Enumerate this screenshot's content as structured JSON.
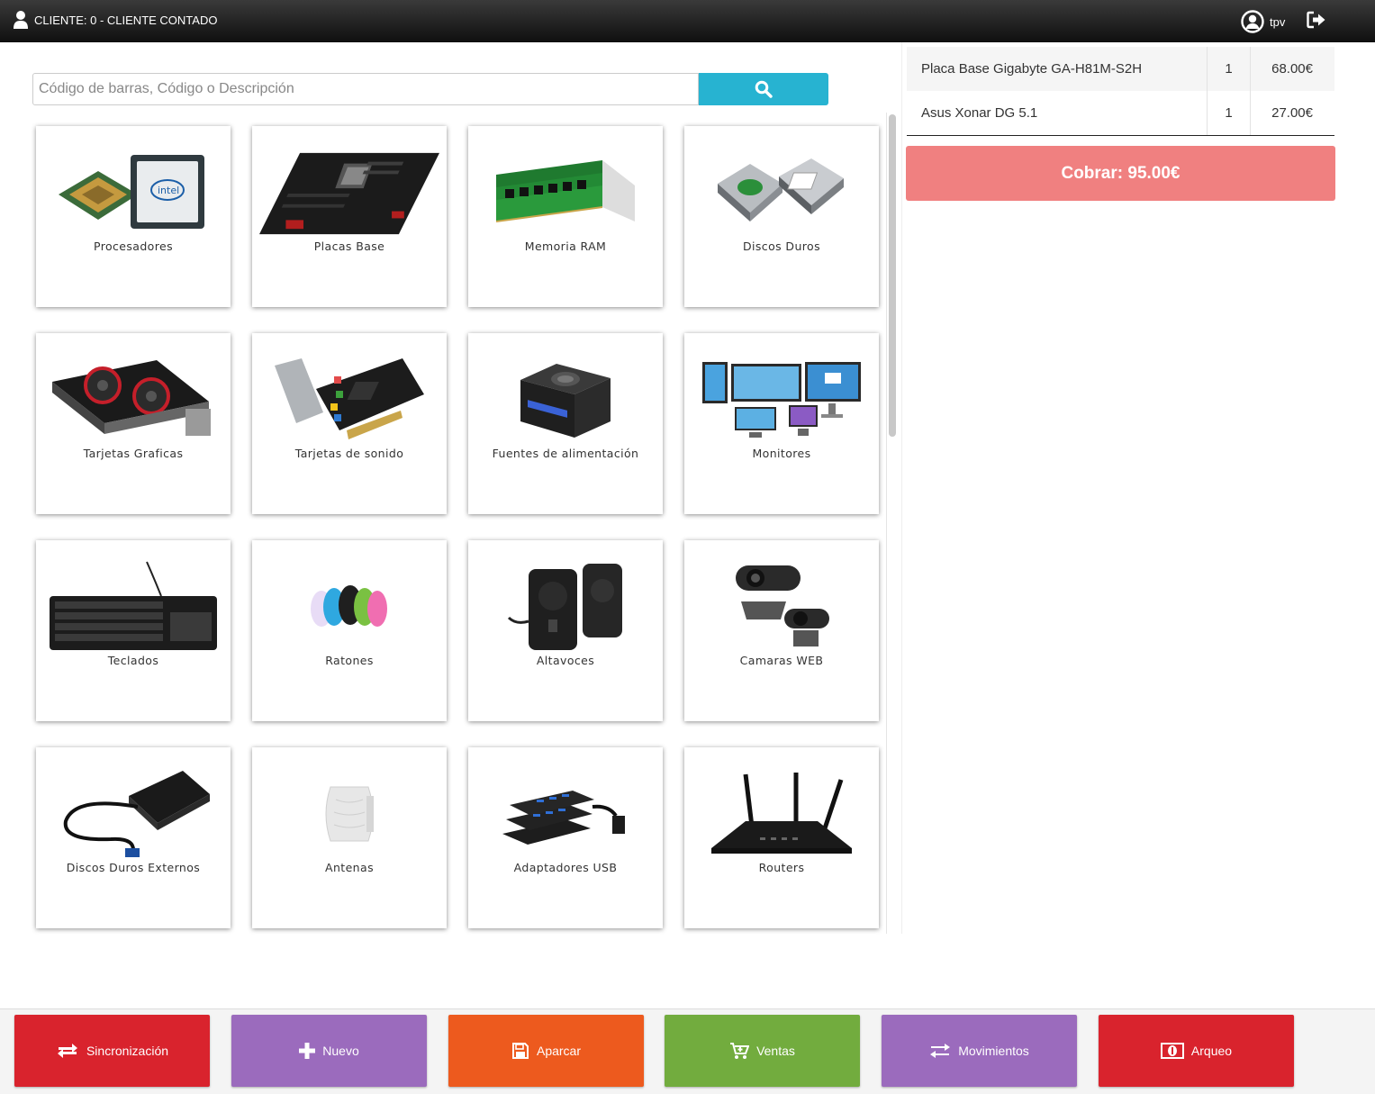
{
  "header": {
    "client_label": "CLIENTE: 0 - CLIENTE CONTADO",
    "user_label": "tpv"
  },
  "search": {
    "placeholder": "Código de barras, Código o Descripción"
  },
  "categories": [
    {
      "label": "Procesadores",
      "icon": "cpu"
    },
    {
      "label": "Placas Base",
      "icon": "motherboard"
    },
    {
      "label": "Memoria RAM",
      "icon": "ram"
    },
    {
      "label": "Discos Duros",
      "icon": "hdd"
    },
    {
      "label": "Tarjetas Graficas",
      "icon": "gpu"
    },
    {
      "label": "Tarjetas de sonido",
      "icon": "soundcard"
    },
    {
      "label": "Fuentes de alimentación",
      "icon": "psu"
    },
    {
      "label": "Monitores",
      "icon": "monitors"
    },
    {
      "label": "Teclados",
      "icon": "keyboard"
    },
    {
      "label": "Ratones",
      "icon": "mice"
    },
    {
      "label": "Altavoces",
      "icon": "speakers"
    },
    {
      "label": "Camaras WEB",
      "icon": "webcam"
    },
    {
      "label": "Discos Duros Externos",
      "icon": "external-hdd"
    },
    {
      "label": "Antenas",
      "icon": "antenna"
    },
    {
      "label": "Adaptadores USB",
      "icon": "usb-hub"
    },
    {
      "label": "Routers",
      "icon": "router"
    }
  ],
  "ticket": {
    "lines": [
      {
        "name": "Placa Base Gigabyte GA-H81M-S2H",
        "qty": "1",
        "price": "68.00€"
      },
      {
        "name": "Asus Xonar DG 5.1",
        "qty": "1",
        "price": "27.00€"
      }
    ],
    "charge_label": "Cobrar: 95.00€"
  },
  "actions": [
    {
      "label": "Sincronización",
      "icon": "sync",
      "color": "#d9232d"
    },
    {
      "label": "Nuevo",
      "icon": "plus",
      "color": "#9b6bbd"
    },
    {
      "label": "Aparcar",
      "icon": "save",
      "color": "#ed5a1e"
    },
    {
      "label": "Ventas",
      "icon": "cart",
      "color": "#72ac3e"
    },
    {
      "label": "Movimientos",
      "icon": "transfer",
      "color": "#9b6bbd"
    },
    {
      "label": "Arqueo",
      "icon": "money",
      "color": "#d9232d"
    }
  ]
}
